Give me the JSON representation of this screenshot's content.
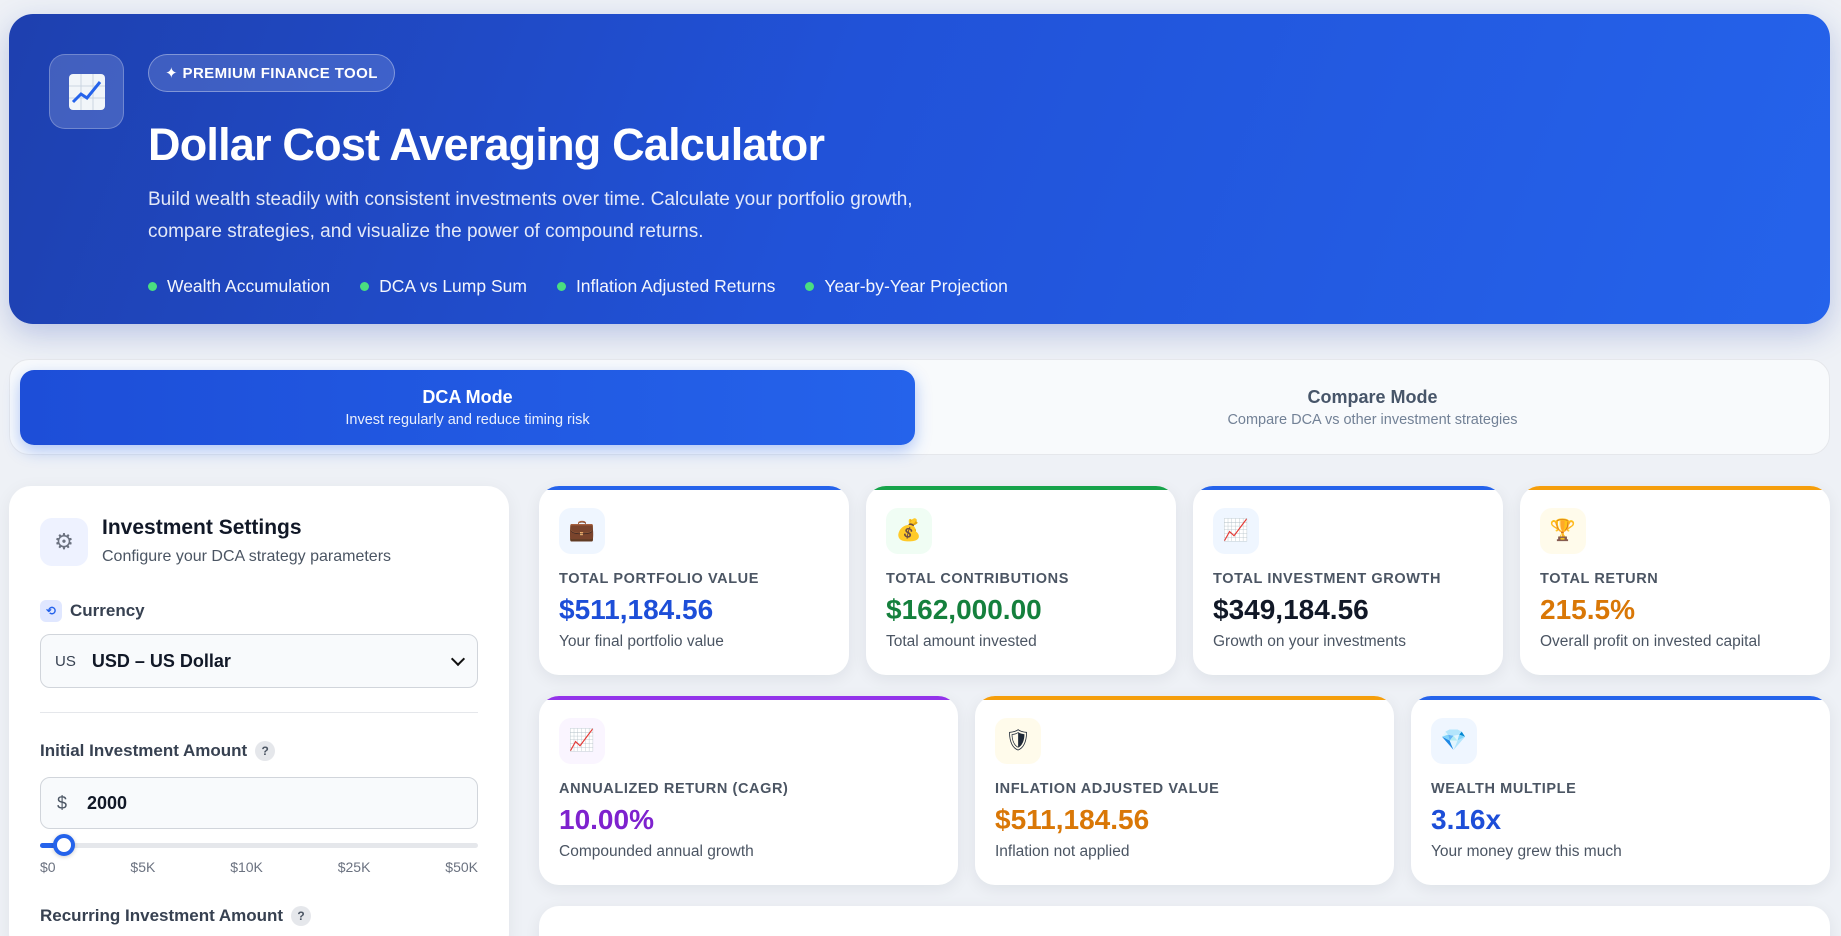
{
  "hero": {
    "badge": "✦ PREMIUM FINANCE TOOL",
    "title": "Dollar Cost Averaging Calculator",
    "description": "Build wealth steadily with consistent investments over time. Calculate your portfolio growth, compare strategies, and visualize the power of compound returns.",
    "features": [
      "Wealth Accumulation",
      "DCA vs Lump Sum",
      "Inflation Adjusted Returns",
      "Year-by-Year Projection"
    ],
    "logo_icon": "chart-increasing-icon"
  },
  "modes": [
    {
      "title": "DCA Mode",
      "subtitle": "Invest regularly and reduce timing risk",
      "active": true
    },
    {
      "title": "Compare Mode",
      "subtitle": "Compare DCA vs other investment strategies",
      "active": false
    }
  ],
  "settings": {
    "title": "Investment Settings",
    "subtitle": "Configure your DCA strategy parameters",
    "currency_label": "Currency",
    "currency_code": "US",
    "currency_value": "USD – US Dollar",
    "initial_label": "Initial Investment Amount",
    "initial_symbol": "$",
    "initial_value": "2000",
    "slider_fraction": 0.055,
    "slider_ticks": [
      "$0",
      "$5K",
      "$10K",
      "$25K",
      "$50K"
    ],
    "recurring_label": "Recurring Investment Amount",
    "help": "?"
  },
  "cards": [
    {
      "label": "TOTAL PORTFOLIO VALUE",
      "value": "$511,184.56",
      "desc": "Your final portfolio value",
      "icon": "briefcase-icon",
      "glyph": "💼",
      "color": "#1d4ed8",
      "bar": "#2563eb",
      "iconbg": "#eff6ff"
    },
    {
      "label": "TOTAL CONTRIBUTIONS",
      "value": "$162,000.00",
      "desc": "Total amount invested",
      "icon": "money-bag-icon",
      "glyph": "💰",
      "color": "#15803d",
      "bar": "#16a34a",
      "iconbg": "#f0fdf4"
    },
    {
      "label": "TOTAL INVESTMENT GROWTH",
      "value": "$349,184.56",
      "desc": "Growth on your investments",
      "icon": "chart-increasing-icon",
      "glyph": "📈",
      "color": "#111827",
      "bar": "#2563eb",
      "iconbg": "#eff6ff"
    },
    {
      "label": "TOTAL RETURN",
      "value": "215.5%",
      "desc": "Overall profit on invested capital",
      "icon": "trophy-icon",
      "glyph": "🏆",
      "color": "#d97706",
      "bar": "#f59e0b",
      "iconbg": "#fffbeb"
    },
    {
      "label": "ANNUALIZED RETURN (CAGR)",
      "value": "10.00%",
      "desc": "Compounded annual growth",
      "icon": "chart-increasing-icon",
      "glyph": "📈",
      "color": "#7e22ce",
      "bar": "#9333ea",
      "iconbg": "#faf5ff"
    },
    {
      "label": "INFLATION ADJUSTED VALUE",
      "value": "$511,184.56",
      "desc": "Inflation not applied",
      "icon": "shield-icon",
      "glyph": "🛡",
      "color": "#d97706",
      "bar": "#f59e0b",
      "iconbg": "#fffbeb"
    },
    {
      "label": "WEALTH MULTIPLE",
      "value": "3.16x",
      "desc": "Your money grew this much",
      "icon": "gem-icon",
      "glyph": "💎",
      "color": "#1d4ed8",
      "bar": "#2563eb",
      "iconbg": "#eff6ff"
    }
  ]
}
